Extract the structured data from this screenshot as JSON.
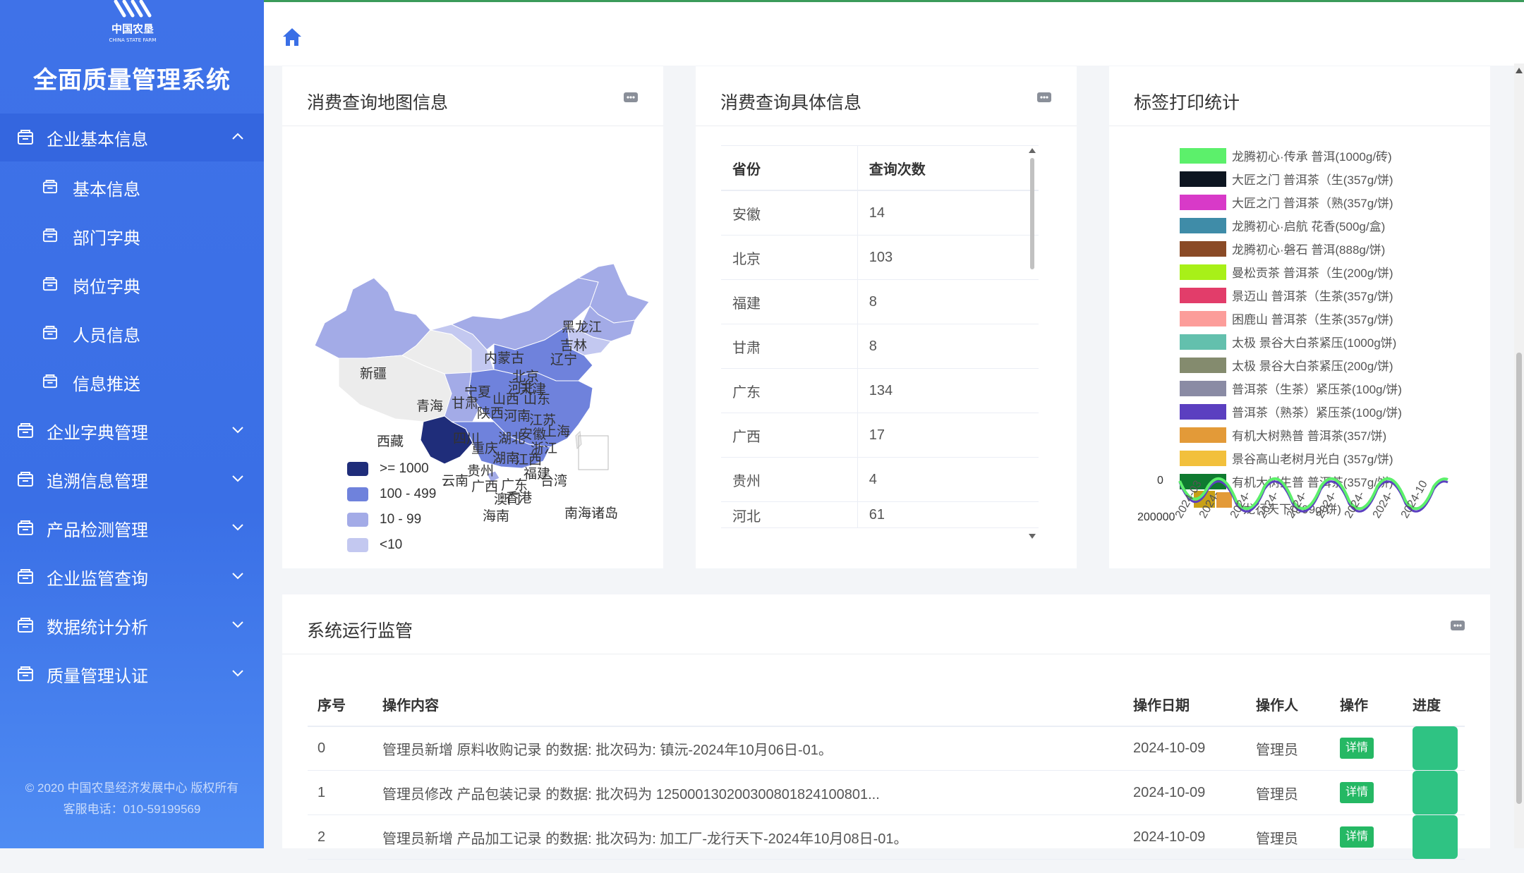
{
  "app": {
    "logo_text": "中国农垦",
    "logo_sub": "CHINA STATE FARM",
    "title": "全面质量管理系统",
    "copyright": "© 2020 中国农垦经济发展中心 版权所有",
    "hotline": "客服电话：010-59199569"
  },
  "sidebar": {
    "groups": [
      {
        "label": "企业基本信息",
        "expanded": true
      },
      {
        "label": "企业字典管理"
      },
      {
        "label": "追溯信息管理"
      },
      {
        "label": "产品检测管理"
      },
      {
        "label": "企业监管查询"
      },
      {
        "label": "数据统计分析"
      },
      {
        "label": "质量管理认证"
      }
    ],
    "subitems": [
      "基本信息",
      "部门字典",
      "岗位字典",
      "人员信息",
      "信息推送"
    ]
  },
  "panels": {
    "map": {
      "title": "消费查询地图信息",
      "legend": [
        {
          "label": ">= 1000",
          "color": "#1f2d7a"
        },
        {
          "label": "100 - 499",
          "color": "#6f82dc"
        },
        {
          "label": "10 - 99",
          "color": "#a3abe7"
        },
        {
          "label": "<10",
          "color": "#c3c8f0"
        }
      ],
      "provinces": [
        "黑龙江",
        "吉林",
        "辽宁",
        "内蒙古",
        "新疆",
        "青海",
        "甘肃",
        "宁夏",
        "山西",
        "河北",
        "北京",
        "天津",
        "山东",
        "陕西",
        "河南",
        "江苏",
        "上海",
        "西藏",
        "四川",
        "重庆",
        "湖北",
        "安徽",
        "浙江",
        "湖南",
        "江西",
        "贵州",
        "福建",
        "云南",
        "广西",
        "广东",
        "台湾",
        "香港",
        "澳门",
        "海南",
        "南海诸岛"
      ]
    },
    "detail": {
      "title": "消费查询具体信息",
      "columns": [
        "省份",
        "查询次数"
      ],
      "rows": [
        [
          "安徽",
          "14"
        ],
        [
          "北京",
          "103"
        ],
        [
          "福建",
          "8"
        ],
        [
          "甘肃",
          "8"
        ],
        [
          "广东",
          "134"
        ],
        [
          "广西",
          "17"
        ],
        [
          "贵州",
          "4"
        ],
        [
          "河北",
          "61"
        ]
      ]
    },
    "labels": {
      "title": "标签打印统计",
      "legend": [
        {
          "label": "龙腾初心·传承 普洱(1000g/砖)",
          "color": "#5cf06b"
        },
        {
          "label": "大匠之门  普洱茶（生(357g/饼)",
          "color": "#0d1520"
        },
        {
          "label": "大匠之门  普洱茶（熟(357g/饼)",
          "color": "#d83ac8"
        },
        {
          "label": "龙腾初心·启航 花香(500g/盒)",
          "color": "#3f8ca8"
        },
        {
          "label": "龙腾初心·磐石 普洱(888g/饼)",
          "color": "#8a4a26"
        },
        {
          "label": "曼松贡茶 普洱茶（生(200g/饼)",
          "color": "#a8f018"
        },
        {
          "label": "景迈山 普洱茶（生茶(357g/饼)",
          "color": "#e23d6a"
        },
        {
          "label": "困鹿山 普洱茶（生茶(357g/饼)",
          "color": "#fc9d9a"
        },
        {
          "label": "太极 景谷大白茶紧压(1000g饼)",
          "color": "#63c0ad"
        },
        {
          "label": "太极 景谷大白茶紧压(200g/饼)",
          "color": "#848b6e"
        },
        {
          "label": "普洱茶（生茶）紧压茶(100g/饼)",
          "color": "#8a8ba4"
        },
        {
          "label": "普洱茶（熟茶）紧压茶(100g/饼)",
          "color": "#5b3fc0"
        },
        {
          "label": "有机大树熟普 普洱茶(357/饼)",
          "color": "#e39a38"
        },
        {
          "label": "景谷高山老树月光白 (357g/饼)",
          "color": "#f2c03c"
        },
        {
          "label": "有机大树生普 普洱茶(357g/饼)",
          "color": "#0f7a30"
        },
        {
          "label": "龙行天下(999g/饼)",
          "color": "#c8a016"
        }
      ],
      "ytick_top": "0",
      "ytick_bottom": "200000",
      "xticks": [
        "2024-03",
        "2024-",
        "2024-",
        "2024-",
        "2024-",
        "2024-",
        "2024-",
        "2024-",
        "2024-10"
      ]
    },
    "monitor": {
      "title": "系统运行监管",
      "columns": [
        "序号",
        "操作内容",
        "操作日期",
        "操作人",
        "操作",
        "进度"
      ],
      "rows": [
        {
          "idx": "0",
          "content": "管理员新增 原料收购记录 的数据: 批次码为: 镇沅-2024年10月06日-01。",
          "date": "2024-10-09",
          "user": "管理员",
          "action": "详情",
          "progress": 1.0
        },
        {
          "idx": "1",
          "content": "管理员修改 产品包装记录 的数据: 批次码为 1250001302003008018241008​01...",
          "date": "2024-10-09",
          "user": "管理员",
          "action": "详情",
          "progress": 1.0
        },
        {
          "idx": "2",
          "content": "管理员新增 产品加工记录 的数据: 批次码为: 加工厂-龙行天下-2024年10月08日-01。",
          "date": "2024-10-09",
          "user": "管理员",
          "action": "详情",
          "progress": 1.0
        }
      ]
    }
  }
}
